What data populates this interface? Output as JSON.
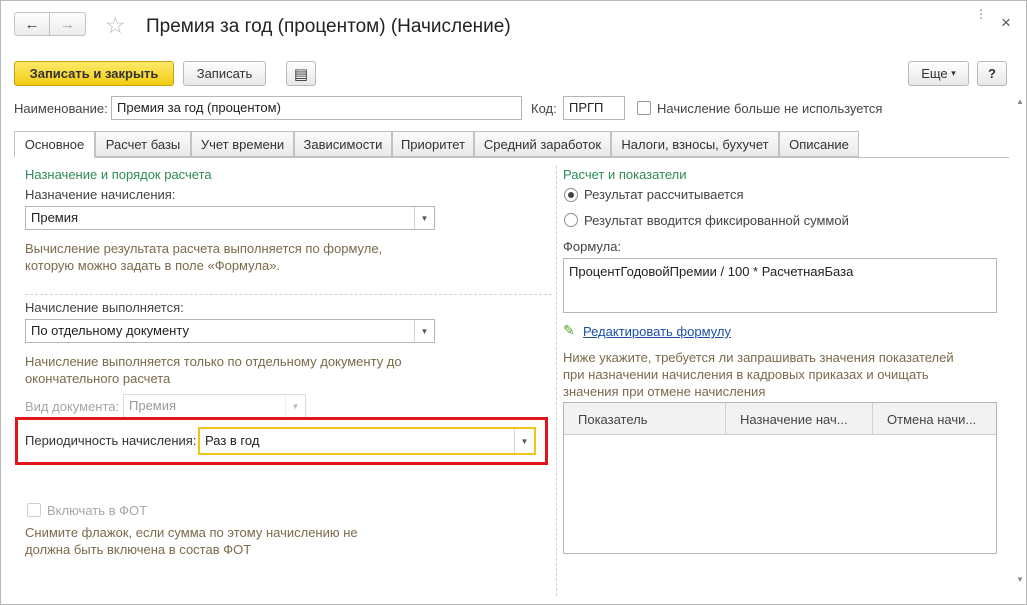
{
  "window": {
    "title": "Премия за год (процентом) (Начисление)",
    "close_glyph": "×",
    "more_glyph": "⋮"
  },
  "nav": {
    "back_glyph": "←",
    "forward_glyph": "→",
    "favorite_glyph": "☆"
  },
  "toolbar": {
    "save_close_label": "Записать и закрыть",
    "save_label": "Записать",
    "list_icon": "▤",
    "more_label": "Еще",
    "more_arrow": "▾",
    "help_label": "?"
  },
  "header": {
    "name_label": "Наименование:",
    "name_value": "Премия за год (процентом)",
    "code_label": "Код:",
    "code_value": "ПРГП",
    "unused_label": "Начисление больше не используется",
    "unused_checked": false
  },
  "tabs": [
    {
      "label": "Основное",
      "active": true
    },
    {
      "label": "Расчет базы",
      "active": false
    },
    {
      "label": "Учет времени",
      "active": false
    },
    {
      "label": "Зависимости",
      "active": false
    },
    {
      "label": "Приоритет",
      "active": false
    },
    {
      "label": "Средний заработок",
      "active": false
    },
    {
      "label": "Налоги, взносы, бухучет",
      "active": false
    },
    {
      "label": "Описание",
      "active": false
    }
  ],
  "left": {
    "section_title": "Назначение и порядок расчета",
    "purpose_label": "Назначение начисления:",
    "purpose_value": "Премия",
    "purpose_hint_1": "Вычисление результата расчета выполняется по формуле,",
    "purpose_hint_2": "которую можно задать в поле «Формула».",
    "execution_label": "Начисление выполняется:",
    "execution_value": "По отдельному документу",
    "execution_hint_1": "Начисление выполняется только по отдельному документу до",
    "execution_hint_2": "окончательного расчета",
    "doc_type_label": "Вид документа:",
    "doc_type_value": "Премия",
    "periodicity_label": "Периодичность начисления:",
    "periodicity_value": "Раз в год",
    "fot_label": "Включать в ФОТ",
    "fot_hint_1": "Снимите флажок, если сумма по этому начислению не",
    "fot_hint_2": "должна быть включена в состав ФОТ"
  },
  "right": {
    "section_title": "Расчет и показатели",
    "radio_calculated": "Результат рассчитывается",
    "radio_fixed": "Результат вводится фиксированной суммой",
    "selected_radio": "calculated",
    "formula_label": "Формула:",
    "formula_value": "ПроцентГодовойПремии / 100 * РасчетнаяБаза",
    "edit_formula_link": "Редактировать формулу",
    "indicators_hint_1": "Ниже укажите, требуется ли запрашивать значения показателей",
    "indicators_hint_2": "при назначении начисления в кадровых приказах и очищать",
    "indicators_hint_3": "значения при отмене начисления",
    "table_columns": [
      "Показатель",
      "Назначение нач...",
      "Отмена начи..."
    ]
  },
  "colors": {
    "primary_button": "#f3cd12",
    "section_title": "#2e8b57",
    "hint_text": "#7a6a4a",
    "highlight_box": "#e0161c",
    "focus_border": "#f0c419",
    "link": "#1b4fa8"
  }
}
